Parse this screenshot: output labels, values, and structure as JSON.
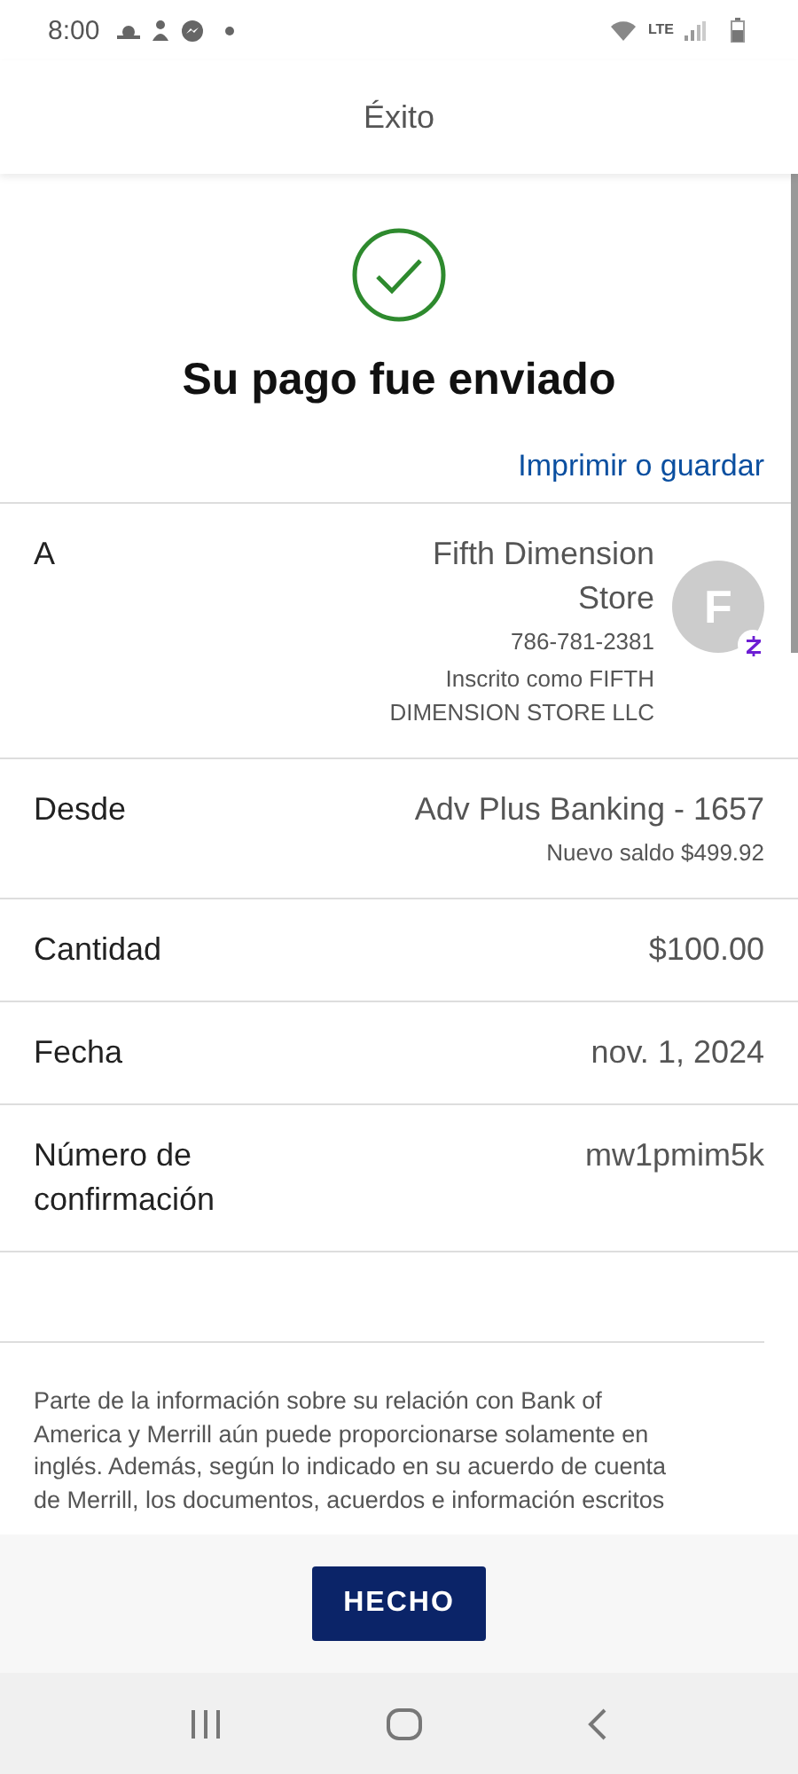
{
  "status_bar": {
    "time": "8:00",
    "network": "LTE"
  },
  "header": {
    "title": "Éxito"
  },
  "result": {
    "title": "Su pago fue enviado",
    "link": "Imprimir o guardar"
  },
  "details": [
    {
      "kind": "recipient",
      "label": "A",
      "value": "Fifth Dimension Store",
      "lines": [
        "786-781-2381",
        "Inscrito como FIFTH DIMENSION STORE LLC"
      ],
      "avatar": "F"
    },
    {
      "kind": "plain",
      "label": "Desde",
      "value": "Adv Plus Banking - 1657",
      "lines": [
        "Nuevo saldo $499.92"
      ]
    },
    {
      "kind": "plain",
      "label": "Cantidad",
      "value": "$100.00"
    },
    {
      "kind": "plain",
      "label": "Fecha",
      "value": "nov. 1, 2024"
    },
    {
      "kind": "plain",
      "label": "Número de confirmación",
      "value": "mw1pmim5k"
    }
  ],
  "disclaimer": [
    "Parte de la información sobre su relación con Bank of",
    "America y Merrill aún puede proporcionarse solamente en",
    "inglés. Además, según lo indicado en su acuerdo de cuenta",
    "de Merrill, los documentos, acuerdos e información escritos"
  ],
  "footer": {
    "button": "HECHO"
  }
}
